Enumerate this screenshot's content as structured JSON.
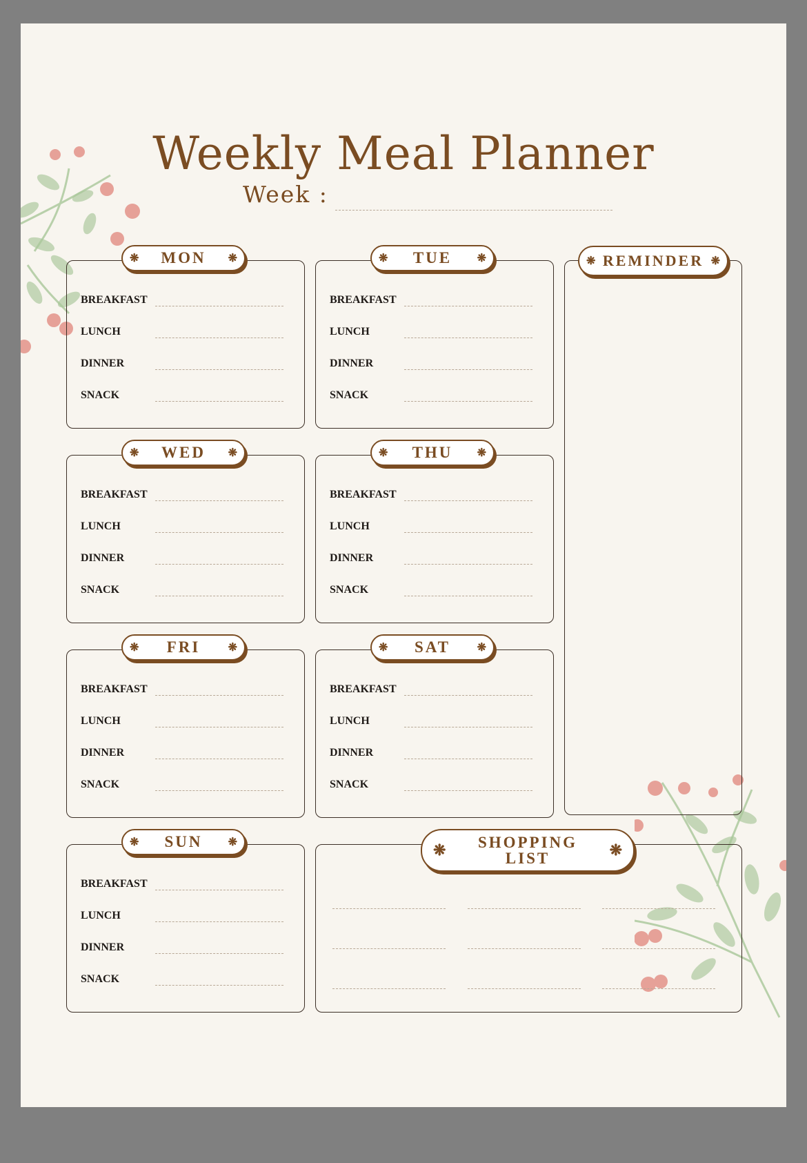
{
  "title": "Weekly Meal Planner",
  "week_label": "Week :",
  "meals": [
    "BREAKFAST",
    "LUNCH",
    "DINNER",
    "SNACK"
  ],
  "days": [
    {
      "label": "MON"
    },
    {
      "label": "TUE"
    },
    {
      "label": "WED"
    },
    {
      "label": "THU"
    },
    {
      "label": "FRI"
    },
    {
      "label": "SAT"
    },
    {
      "label": "SUN"
    }
  ],
  "reminder_label": "REMINDER",
  "shopping_label_line1": "SHOPPING",
  "shopping_label_line2": "LIST",
  "tab_ornament": "❋",
  "colors": {
    "brown": "#7a4c22",
    "background": "#f8f5ef",
    "frame": "#808080",
    "berry": "#e3938a",
    "leaf": "#a9c79a"
  }
}
